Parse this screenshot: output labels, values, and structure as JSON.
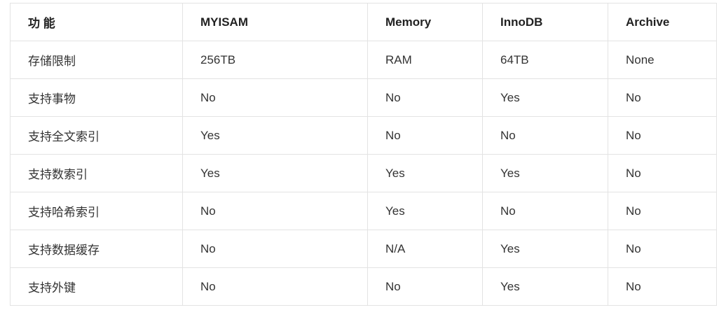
{
  "table": {
    "headers": [
      "功 能",
      "MYISAM",
      "Memory",
      "InnoDB",
      "Archive"
    ],
    "rows": [
      [
        "存储限制",
        "256TB",
        "RAM",
        "64TB",
        "None"
      ],
      [
        "支持事物",
        "No",
        "No",
        "Yes",
        "No"
      ],
      [
        "支持全文索引",
        "Yes",
        "No",
        "No",
        "No"
      ],
      [
        "支持数索引",
        "Yes",
        "Yes",
        "Yes",
        "No"
      ],
      [
        "支持哈希索引",
        "No",
        "Yes",
        "No",
        "No"
      ],
      [
        "支持数据缓存",
        "No",
        "N/A",
        "Yes",
        "No"
      ],
      [
        "支持外键",
        "No",
        "No",
        "Yes",
        "No"
      ]
    ]
  }
}
